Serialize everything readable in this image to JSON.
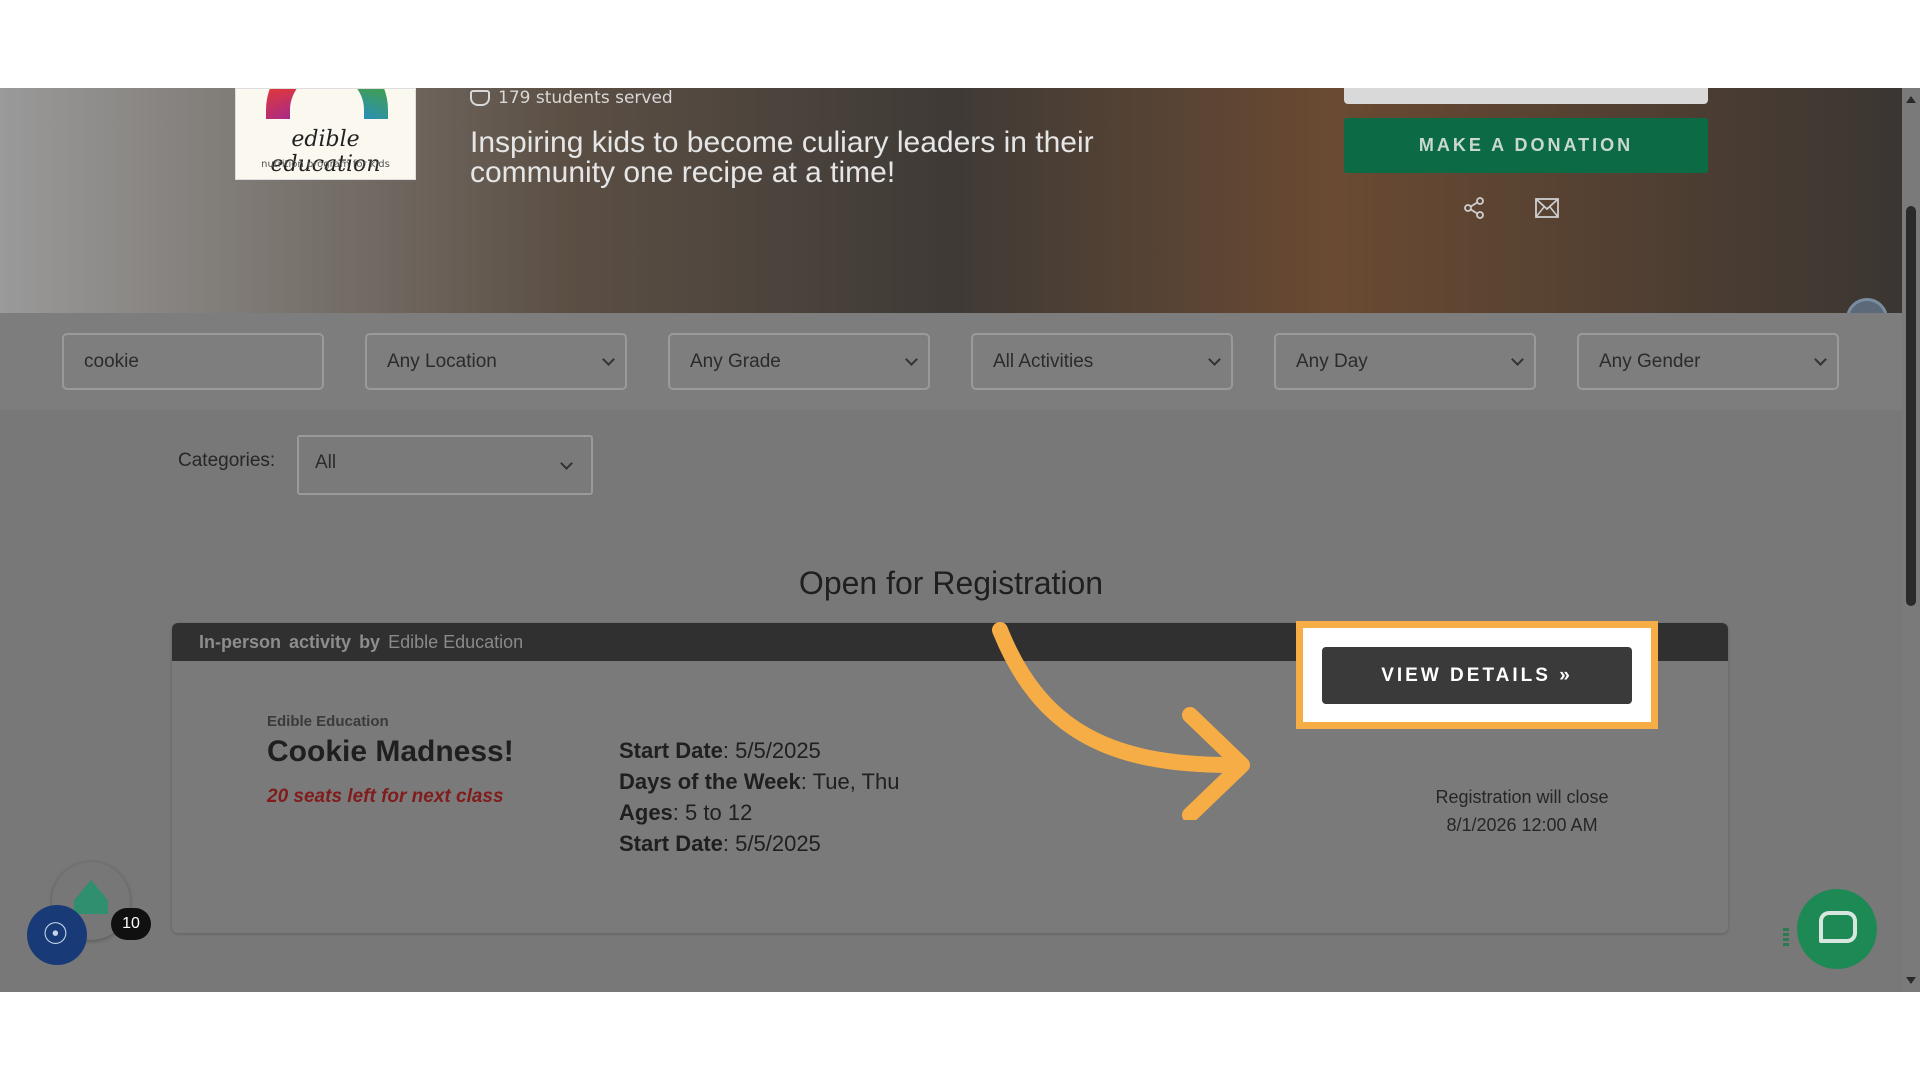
{
  "hero": {
    "logo_name": "edible education",
    "logo_sub": "nutrition program for kids",
    "students_served": "179 students served",
    "tagline": "Inspiring kids to become culiary leaders in their community one recipe at a time!",
    "donate_label": "MAKE A DONATION"
  },
  "filters": {
    "search_value": "cookie",
    "location": "Any Location",
    "grade": "Any Grade",
    "activities": "All Activities",
    "day": "Any Day",
    "gender": "Any Gender"
  },
  "categories": {
    "label": "Categories:",
    "selected": "All"
  },
  "section_title": "Open for Registration",
  "card": {
    "type_label": "In-person",
    "activity_label": "activity",
    "by_label": "by",
    "provider": "Edible Education",
    "org": "Edible Education",
    "title": "Cookie Madness!",
    "seats": "20 seats left for next class",
    "details": [
      {
        "label": "Start Date",
        "value": "5/5/2025"
      },
      {
        "label": "Days of the Week",
        "value": "Tue, Thu"
      },
      {
        "label": "Ages",
        "value": "5 to 12"
      },
      {
        "label": "Start Date",
        "value": "5/5/2025"
      }
    ],
    "view_label": "VIEW DETAILS »",
    "close_note": "Registration will close",
    "close_date": "8/1/2026 12:00 AM"
  },
  "widgets": {
    "badge_count": "10"
  },
  "colors": {
    "donate": "#0c6b45",
    "highlight": "#f6ad45",
    "accent_arrow": "#f6ad45",
    "chat": "#1d8a55",
    "accessibility": "#183a77"
  }
}
